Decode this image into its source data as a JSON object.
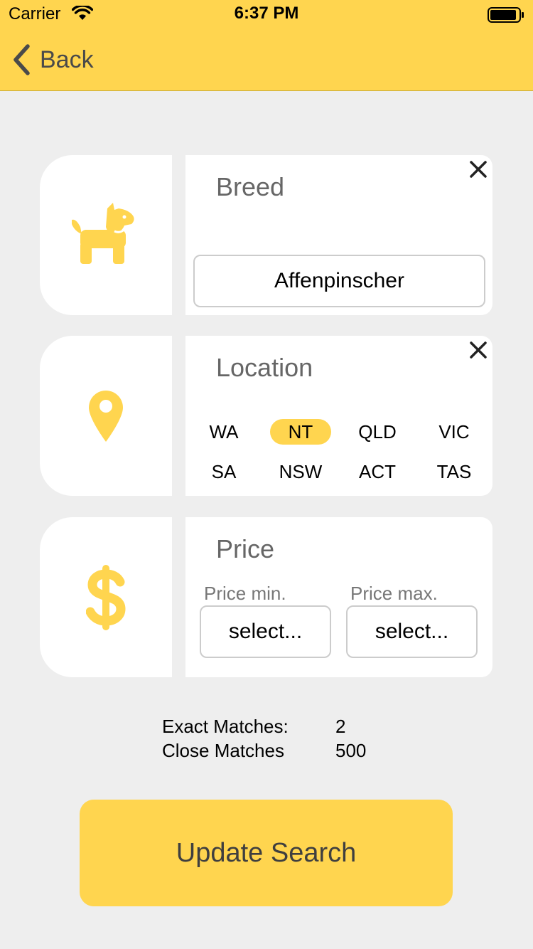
{
  "status_bar": {
    "carrier": "Carrier",
    "time": "6:37 PM"
  },
  "nav": {
    "back_label": "Back"
  },
  "colors": {
    "accent": "#ffd54f",
    "background": "#eeeeee",
    "card": "#ffffff",
    "title_text": "#666666"
  },
  "breed": {
    "title": "Breed",
    "icon": "dog-icon",
    "value": "Affenpinscher"
  },
  "location": {
    "title": "Location",
    "icon": "map-pin-icon",
    "regions": [
      {
        "label": "WA",
        "selected": false
      },
      {
        "label": "NT",
        "selected": true
      },
      {
        "label": "QLD",
        "selected": false
      },
      {
        "label": "VIC",
        "selected": false
      },
      {
        "label": "SA",
        "selected": false
      },
      {
        "label": "NSW",
        "selected": false
      },
      {
        "label": "ACT",
        "selected": false
      },
      {
        "label": "TAS",
        "selected": false
      }
    ]
  },
  "price": {
    "title": "Price",
    "icon": "dollar-icon",
    "min_label": "Price min.",
    "max_label": "Price max.",
    "min_value": "select...",
    "max_value": "select..."
  },
  "matches": {
    "exact_label": "Exact Matches:",
    "exact_value": "2",
    "close_label": "Close Matches",
    "close_value": "500"
  },
  "update_button": {
    "label": "Update Search"
  }
}
